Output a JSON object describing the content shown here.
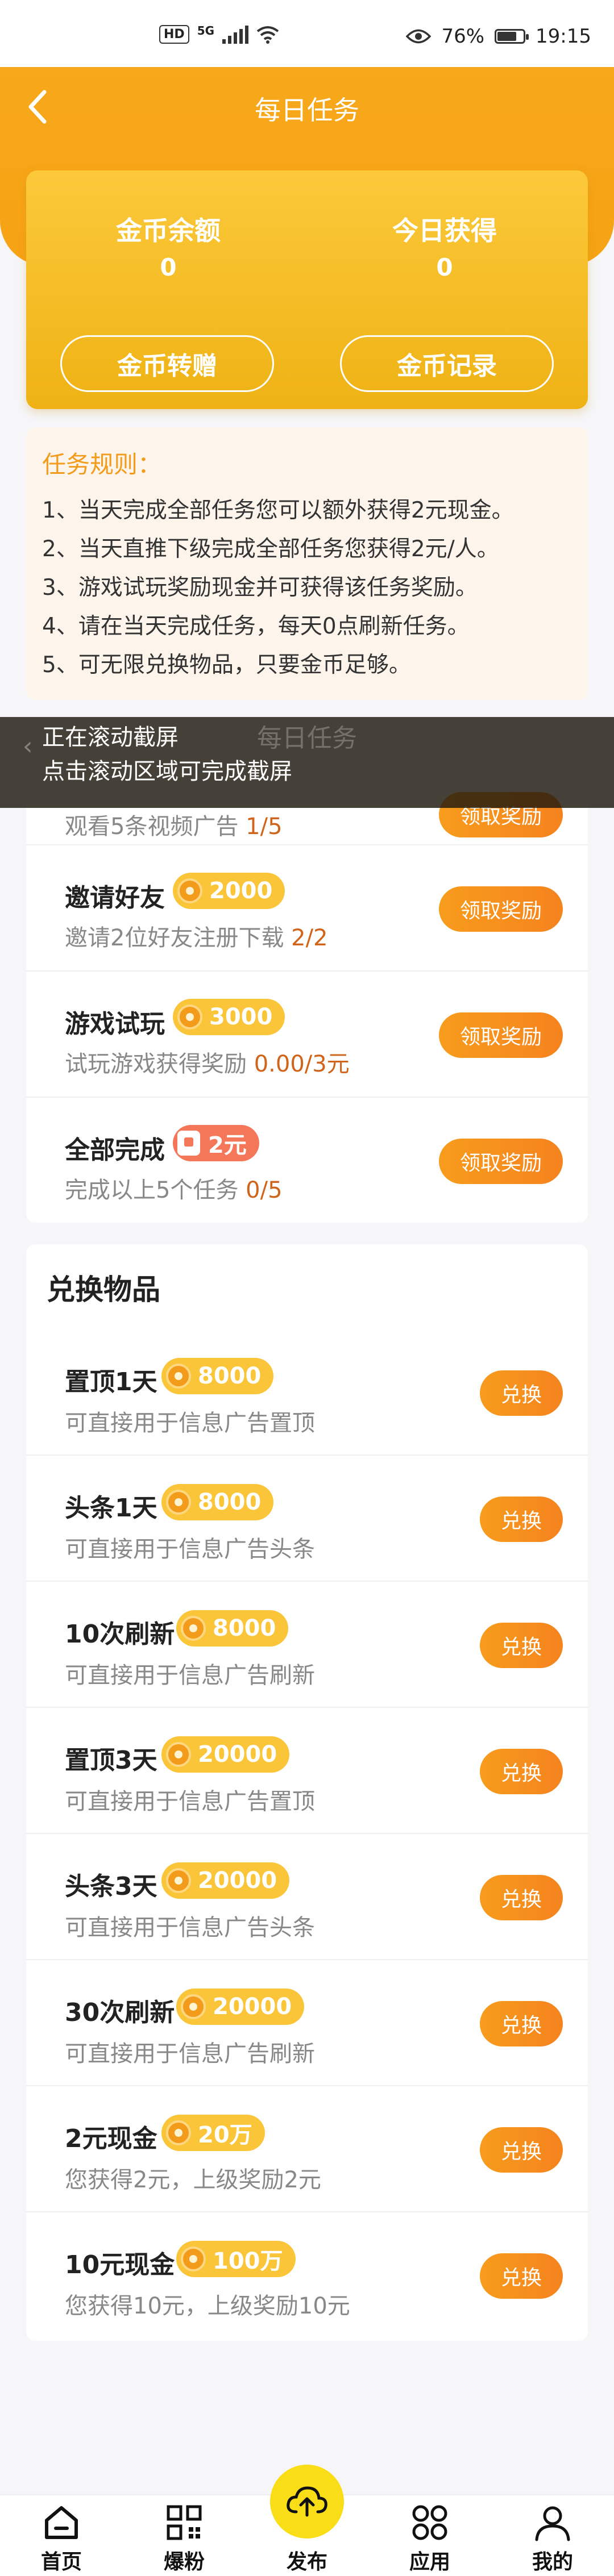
{
  "status_bar": {
    "hd": "HD",
    "network": "5G",
    "battery": "76%",
    "battery_level": 0.76,
    "time": "19:15"
  },
  "header": {
    "title": "每日任务"
  },
  "coin_card": {
    "balance_label": "金币余额",
    "balance_value": "0",
    "today_label": "今日获得",
    "today_value": "0",
    "transfer_button": "金币转赠",
    "record_button": "金币记录"
  },
  "rules": {
    "title": "任务规则：",
    "items": [
      "1、当天完成全部任务您可以额外获得2元现金。",
      "2、当天直推下级完成全部任务您获得2元/人。",
      "3、游戏试玩奖励现金并可获得该任务奖励。",
      "4、请在当天完成任务，每天0点刷新任务。",
      "5、可无限兑换物品，只要金币足够。"
    ]
  },
  "scroll_overlay": {
    "line1": "正在滚动截屏",
    "line2": "点击滚动区域可完成截屏",
    "ghost_title": "每日任务"
  },
  "tasks": {
    "partial": {
      "desc": "观看5条视频广告",
      "progress": "1/5",
      "button": "领取奖励"
    },
    "items": [
      {
        "name": "邀请好友",
        "reward": "2000",
        "desc": "邀请2位好友注册下载",
        "progress": "2/2",
        "button": "领取奖励"
      },
      {
        "name": "游戏试玩",
        "reward": "3000",
        "desc": "试玩游戏获得奖励",
        "progress": "0.00/3元",
        "button": "领取奖励"
      },
      {
        "name": "全部完成",
        "reward": "2元",
        "desc": "完成以上5个任务",
        "progress": "0/5",
        "button": "领取奖励"
      }
    ]
  },
  "exchange": {
    "title": "兑换物品",
    "items": [
      {
        "name": "置顶1天",
        "cost": "8000",
        "desc": "可直接用于信息广告置顶",
        "button": "兑换"
      },
      {
        "name": "头条1天",
        "cost": "8000",
        "desc": "可直接用于信息广告头条",
        "button": "兑换"
      },
      {
        "name": "10次刷新",
        "cost": "8000",
        "desc": "可直接用于信息广告刷新",
        "button": "兑换"
      },
      {
        "name": "置顶3天",
        "cost": "20000",
        "desc": "可直接用于信息广告置顶",
        "button": "兑换"
      },
      {
        "name": "头条3天",
        "cost": "20000",
        "desc": "可直接用于信息广告头条",
        "button": "兑换"
      },
      {
        "name": "30次刷新",
        "cost": "20000",
        "desc": "可直接用于信息广告刷新",
        "button": "兑换"
      },
      {
        "name": "2元现金",
        "cost": "20万",
        "desc": "您获得2元，上级奖励2元",
        "button": "兑换"
      },
      {
        "name": "10元现金",
        "cost": "100万",
        "desc": "您获得10元，上级奖励10元",
        "button": "兑换"
      }
    ]
  },
  "tabbar": {
    "items": [
      {
        "label": "首页",
        "icon": "home-icon"
      },
      {
        "label": "爆粉",
        "icon": "qrcode-icon"
      },
      {
        "label": "发布",
        "icon": "upload-cloud-icon"
      },
      {
        "label": "应用",
        "icon": "apps-grid-icon"
      },
      {
        "label": "我的",
        "icon": "user-icon"
      }
    ]
  }
}
